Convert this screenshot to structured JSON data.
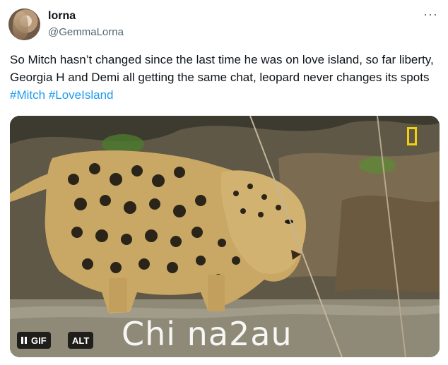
{
  "tweet": {
    "display_name": "lorna",
    "handle": "@GemmaLorna",
    "more_icon": "more-horizontal-icon",
    "text": "So Mitch hasn’t changed since the last time he was on love island, so far liberty, Georgia H and Demi all getting the same chat, leopard never changes its spots ",
    "hashtags": [
      "#Mitch",
      "#LoveIsland"
    ]
  },
  "media": {
    "gif_label": "GIF",
    "alt_label": "ALT",
    "watermark": "Chi na2au",
    "logo_color": "#f4d20a"
  }
}
